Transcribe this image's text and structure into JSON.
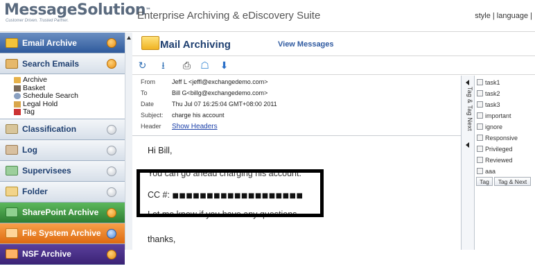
{
  "logo": {
    "name": "MessageSolution",
    "tm": "™",
    "tagline": "Customer Driven. Trusted Partner."
  },
  "suite_title": "Enterprise Archiving & eDiscovery Suite",
  "top_links": "style | language |",
  "sidebar": {
    "email_archive": "Email Archive",
    "search_emails": "Search Emails",
    "tree": [
      "Archive",
      "Basket",
      "Schedule Search",
      "Legal Hold",
      "Tag"
    ],
    "classification": "Classification",
    "log": "Log",
    "supervisees": "Supervisees",
    "folder": "Folder",
    "sharepoint_archive": "SharePoint Archive",
    "file_system_archive": "File System Archive",
    "nsf_archive": "NSF Archive"
  },
  "main": {
    "title": "Mail Archiving",
    "view_messages": "View Messages",
    "headers": {
      "from_label": "From",
      "from": "Jeff L <jeffl@exchangedemo.com>",
      "to_label": "To",
      "to": "Bill G<billg@exchangedemo.com>",
      "date_label": "Date",
      "date": "Thu Jul 07 16:25:04 GMT+08:00 2011",
      "subject_label": "Subject:",
      "subject": "charge his account",
      "header_label": "Header",
      "show_headers": "Show Headers"
    },
    "body": {
      "greeting": "Hi Bill,",
      "line1": "You can go ahead charging his account.",
      "cc_label": "CC #:",
      "cc_mask": "■■■■■■■■■■■■■■■■■■■",
      "line2": "Let me know if you have any questions.",
      "closing": "thanks,"
    }
  },
  "tag_panel": {
    "vertical_tab_1": "Tag & Tag Next",
    "tags": [
      "task1",
      "task2",
      "task3",
      "important",
      "ignore",
      "Responsive",
      "Privileged",
      "Reviewed",
      "aaa"
    ],
    "tag_button": "Tag",
    "tag_next_button": "Tag & Next"
  },
  "colors": {
    "brand_blue": "#2f5a9c",
    "accent_orange": "#e88f14",
    "sharepoint_green": "#2e7d32",
    "nsf_purple": "#3b2375"
  }
}
